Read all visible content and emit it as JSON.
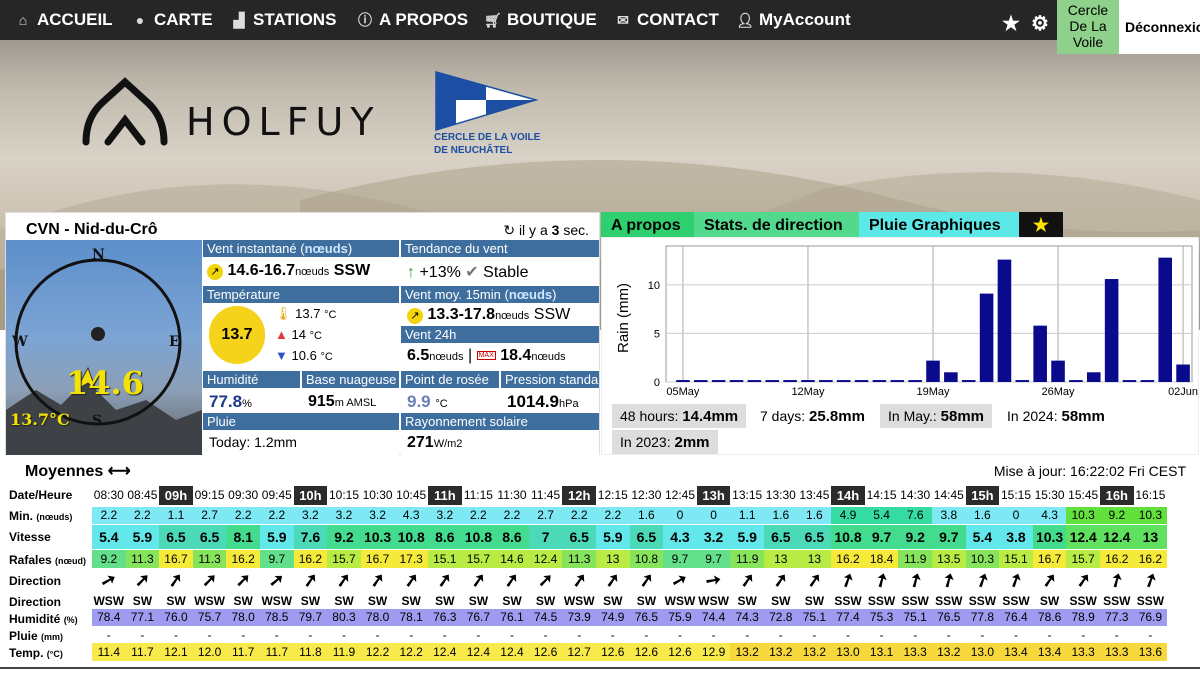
{
  "nav": {
    "items": [
      {
        "label": "ACCUEIL",
        "icon": "home-icon"
      },
      {
        "label": "CARTE",
        "icon": "globe-icon"
      },
      {
        "label": "STATIONS",
        "icon": "chart-icon"
      },
      {
        "label": "A PROPOS",
        "icon": "info-icon"
      },
      {
        "label": "BOUTIQUE",
        "icon": "cart-icon"
      },
      {
        "label": "CONTACT",
        "icon": "envelope-icon"
      },
      {
        "label": "MyAccount",
        "icon": "user-icon"
      }
    ],
    "club_button": "Cercle De La Voile",
    "logout_label": "Déconnexio"
  },
  "brand": {
    "holfuy": "HOLFUY",
    "club_line1": "CERCLE DE LA VOILE",
    "club_line2": "DE NEUCHÂTEL"
  },
  "station": {
    "name": "CVN - Nid-du-Crô",
    "ago_prefix": "il y a",
    "ago_value": "3",
    "ago_suffix": "sec.",
    "compass": {
      "n": "N",
      "s": "S",
      "e": "E",
      "w": "W",
      "speed": "14.6",
      "temp": "13.7°C"
    }
  },
  "panels": {
    "wind_now": {
      "hdr_a": "Vent instantané (",
      "hdr_unit": "nœuds",
      "hdr_b": ")",
      "value": "14.6-16.7",
      "unit": "nœuds",
      "dir": "SSW"
    },
    "trend": {
      "hdr": "Tendance du vent",
      "pct": "+13%",
      "state": "Stable"
    },
    "temperature": {
      "hdr": "Température",
      "current": "13.7",
      "high": "13.7",
      "mid": "14",
      "low": "10.6",
      "unit": "°C"
    },
    "wind_avg": {
      "hdr_a": "Vent moy. 15min (",
      "hdr_unit": "nœuds",
      "hdr_b": ")",
      "value": "13.3-17.8",
      "unit": "nœuds",
      "dir": "SSW"
    },
    "wind24": {
      "hdr": "Vent 24h",
      "avg": "6.5",
      "avg_unit": "nœuds",
      "sep": "|",
      "max_badge": "MAX",
      "max": "18.4",
      "max_unit": "nœuds"
    },
    "humidity": {
      "hdr": "Humidité",
      "value": "77.8",
      "unit": "%"
    },
    "cloudbase": {
      "hdr": "Base nuageuse",
      "value": "915",
      "unit": "m AMSL"
    },
    "dewpoint": {
      "hdr": "Point de rosée",
      "value": "9.9",
      "unit": "°C"
    },
    "pressure": {
      "hdr": "Pression standa",
      "value": "1014.9",
      "unit": "hPa"
    },
    "rain": {
      "hdr": "Pluie",
      "text": "Today: 1.2mm"
    },
    "solar": {
      "hdr": "Rayonnement solaire",
      "value": "271",
      "unit": "W/m2"
    }
  },
  "tabs": [
    {
      "label": "A propos",
      "bg": "#2fcf6f"
    },
    {
      "label": "Stats. de direction",
      "bg": "#52d98e"
    },
    {
      "label": "Pluie Graphiques",
      "bg": "#5de8e8"
    }
  ],
  "chart_data": {
    "type": "bar",
    "ylabel": "Rain (mm)",
    "ylim": [
      0,
      14
    ],
    "yticks": [
      0,
      5,
      10
    ],
    "xticks": [
      "05May",
      "12May",
      "19May",
      "26May",
      "02Jun"
    ],
    "values": [
      0.2,
      0.2,
      0.2,
      0.2,
      0.2,
      0.2,
      0.2,
      0.2,
      0.2,
      0.2,
      0.2,
      0.2,
      0.2,
      0.2,
      2.2,
      1.0,
      0.2,
      9.1,
      12.6,
      0.2,
      5.8,
      2.2,
      0.2,
      1.0,
      10.6,
      0.2,
      0.2,
      12.8,
      1.8
    ],
    "color": "#0a0a8c"
  },
  "rain_stats": [
    {
      "label": "48 hours:",
      "value": "14.4mm"
    },
    {
      "label": "7 days:",
      "value": "25.8mm"
    },
    {
      "label": "In May.:",
      "value": "58mm"
    },
    {
      "label": "In 2024:",
      "value": "58mm"
    },
    {
      "label": "In 2023:",
      "value": "2mm"
    }
  ],
  "moyennes": {
    "title": "Moyennes",
    "arrow": "⟷",
    "update": "Mise à jour: 16:22:02 Fri CEST"
  },
  "table": {
    "labels": {
      "date": "Date/Heure",
      "min": "Min.",
      "min_unit": "(nœuds)",
      "vitesse": "Vitesse",
      "rafales": "Rafales",
      "rafales_unit": "(nœud)",
      "dir_arrow": "Direction",
      "dir_text": "Direction",
      "hum": "Humidité",
      "hum_unit": "(%)",
      "pluie": "Pluie",
      "pluie_unit": "(mm)",
      "temp": "Temp.",
      "temp_unit": "(°C)"
    },
    "times": [
      "08:30",
      "08:45",
      "09h",
      "09:15",
      "09:30",
      "09:45",
      "10h",
      "10:15",
      "10:30",
      "10:45",
      "11h",
      "11:15",
      "11:30",
      "11:45",
      "12h",
      "12:15",
      "12:30",
      "12:45",
      "13h",
      "13:15",
      "13:30",
      "13:45",
      "14h",
      "14:15",
      "14:30",
      "14:45",
      "15h",
      "15:15",
      "15:30",
      "15:45",
      "16h",
      "16:15"
    ],
    "hours": [
      2,
      6,
      10,
      14,
      18,
      22,
      26,
      30
    ],
    "min": [
      "2.2",
      "2.2",
      "1.1",
      "2.7",
      "2.2",
      "2.2",
      "3.2",
      "3.2",
      "3.2",
      "4.3",
      "3.2",
      "2.2",
      "2.2",
      "2.7",
      "2.2",
      "2.2",
      "1.6",
      "0",
      "0",
      "1.1",
      "1.6",
      "1.6",
      "4.9",
      "5.4",
      "7.6",
      "3.8",
      "1.6",
      "0",
      "4.3",
      "10.3",
      "9.2",
      "10.3"
    ],
    "vitesse": [
      "5.4",
      "5.9",
      "6.5",
      "6.5",
      "8.1",
      "5.9",
      "7.6",
      "9.2",
      "10.3",
      "10.8",
      "8.6",
      "10.8",
      "8.6",
      "7",
      "6.5",
      "5.9",
      "6.5",
      "4.3",
      "3.2",
      "5.9",
      "6.5",
      "6.5",
      "10.8",
      "9.7",
      "9.2",
      "9.7",
      "5.4",
      "3.8",
      "10.3",
      "12.4",
      "12.4",
      "13"
    ],
    "rafales": [
      "9.2",
      "11.3",
      "16.7",
      "11.3",
      "16.2",
      "9.7",
      "16.2",
      "15.7",
      "16.7",
      "17.3",
      "15.1",
      "15.7",
      "14.6",
      "12.4",
      "11.3",
      "13",
      "10.8",
      "9.7",
      "9.7",
      "11.9",
      "13",
      "13",
      "16.2",
      "18.4",
      "11.9",
      "13.5",
      "10.3",
      "15.1",
      "16.7",
      "15.7",
      "16.2",
      "16.2"
    ],
    "dir_deg": [
      60,
      45,
      35,
      45,
      45,
      50,
      35,
      35,
      35,
      35,
      35,
      35,
      35,
      45,
      35,
      35,
      35,
      60,
      80,
      35,
      35,
      35,
      20,
      15,
      15,
      15,
      20,
      20,
      35,
      35,
      15,
      20
    ],
    "dirs": [
      "WSW",
      "SW",
      "SW",
      "WSW",
      "SW",
      "WSW",
      "SW",
      "SW",
      "SW",
      "SW",
      "SW",
      "SW",
      "SW",
      "SW",
      "WSW",
      "SW",
      "SW",
      "WSW",
      "WSW",
      "SW",
      "SW",
      "SW",
      "SSW",
      "SSW",
      "SSW",
      "SSW",
      "SSW",
      "SSW",
      "SW",
      "SSW",
      "SSW",
      "SSW"
    ],
    "hum": [
      "78.4",
      "77.1",
      "76.0",
      "75.7",
      "78.0",
      "78.5",
      "79.7",
      "80.3",
      "78.0",
      "78.1",
      "76.3",
      "76.7",
      "76.1",
      "74.5",
      "73.9",
      "74.9",
      "76.5",
      "75.9",
      "74.4",
      "74.3",
      "72.8",
      "75.1",
      "77.4",
      "75.3",
      "75.1",
      "76.5",
      "77.8",
      "76.4",
      "78.6",
      "78.9",
      "77.3",
      "76.9"
    ],
    "pluie": [
      "-",
      "-",
      "-",
      "-",
      "-",
      "-",
      "-",
      "-",
      "-",
      "-",
      "-",
      "-",
      "-",
      "-",
      "-",
      "-",
      "-",
      "-",
      "-",
      "-",
      "-",
      "-",
      "-",
      "-",
      "-",
      "-",
      "-",
      "-",
      "-",
      "-",
      "-",
      "-"
    ],
    "temp": [
      "11.4",
      "11.7",
      "12.1",
      "12.0",
      "11.7",
      "11.7",
      "11.8",
      "11.9",
      "12.2",
      "12.2",
      "12.4",
      "12.4",
      "12.4",
      "12.6",
      "12.7",
      "12.6",
      "12.6",
      "12.6",
      "12.9",
      "13.2",
      "13.2",
      "13.2",
      "13.0",
      "13.1",
      "13.3",
      "13.2",
      "13.0",
      "13.4",
      "13.4",
      "13.3",
      "13.3",
      "13.6"
    ]
  }
}
